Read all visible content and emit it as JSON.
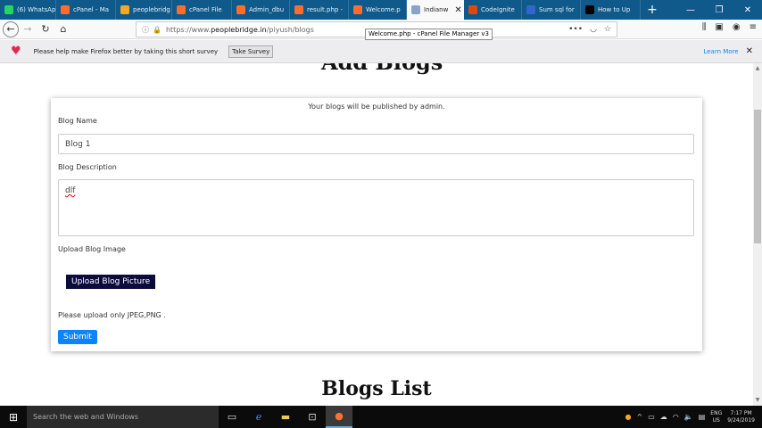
{
  "tabs": [
    {
      "label": "(6) WhatsAp",
      "icon": "whatsapp-icon",
      "color": "#25d366"
    },
    {
      "label": "cPanel - Ma",
      "icon": "cpanel-icon",
      "color": "#ff6c2c"
    },
    {
      "label": "peoplebridg",
      "icon": "peoplebridge-icon",
      "color": "#f5a623"
    },
    {
      "label": "cPanel File",
      "icon": "cpanel-icon",
      "color": "#ff6c2c"
    },
    {
      "label": "Admin_dbu",
      "icon": "cpanel-icon",
      "color": "#ff6c2c"
    },
    {
      "label": "result.php -",
      "icon": "cpanel-icon",
      "color": "#ff6c2c"
    },
    {
      "label": "Welcome.p",
      "icon": "cpanel-icon",
      "color": "#ff6c2c"
    },
    {
      "label": "Indianw",
      "icon": "diamond-icon",
      "color": "#8aa4c8",
      "active": true
    },
    {
      "label": "CodeIgnite",
      "icon": "codeigniter-icon",
      "color": "#dd4814"
    },
    {
      "label": "Sum sql for",
      "icon": "sql-icon",
      "color": "#3366cc"
    },
    {
      "label": "How to Up",
      "icon": "rc-icon",
      "color": "#000000"
    }
  ],
  "url": {
    "prefix": "https://www.",
    "domain": "peoplebridge.in",
    "path": "/piyush/blogs"
  },
  "tooltip": "Welcome.php - cPanel File Manager v3",
  "notification": {
    "message": "Please help make Firefox better by taking this short survey",
    "button": "Take Survey",
    "link": "Learn More"
  },
  "form": {
    "partial_title": "Add Blogs",
    "note": "Your blogs will be published by admin.",
    "name_label": "Blog Name",
    "name_value": "Blog 1",
    "desc_label": "Blog Description",
    "desc_value": "dlf",
    "image_label": "Upload Blog Image",
    "upload_button": "Upload Blog Picture",
    "hint": "Please upload only JPEG,PNG .",
    "submit": "Submit"
  },
  "blogs_list_title": "Blogs List",
  "taskbar": {
    "search_placeholder": "Search the web and Windows",
    "lang_top": "ENG",
    "lang_bottom": "US",
    "time": "7:17 PM",
    "date": "9/24/2019"
  }
}
